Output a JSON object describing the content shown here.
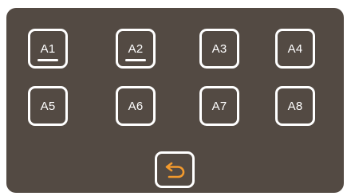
{
  "keys": [
    {
      "label": "A1",
      "active": true
    },
    {
      "label": "A2",
      "active": true
    },
    {
      "label": "A3",
      "active": false
    },
    {
      "label": "A4",
      "active": false
    },
    {
      "label": "A5",
      "active": false
    },
    {
      "label": "A6",
      "active": false
    },
    {
      "label": "A7",
      "active": false
    },
    {
      "label": "A8",
      "active": false
    }
  ],
  "back_button": {
    "icon": "return-arrow-icon"
  },
  "colors": {
    "panel": "#534a43",
    "key_border": "#ffffff",
    "key_text": "#ffffff",
    "back_icon": "#f39a2d"
  }
}
